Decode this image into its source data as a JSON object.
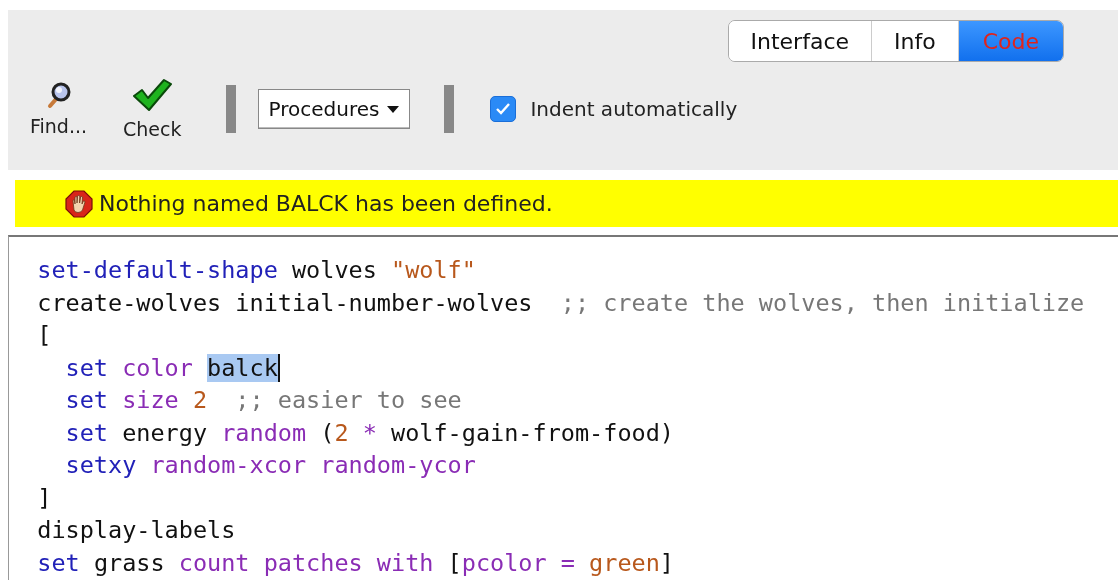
{
  "tabs": [
    {
      "label": "Interface",
      "selected": false
    },
    {
      "label": "Info",
      "selected": false
    },
    {
      "label": "Code",
      "selected": true
    }
  ],
  "toolbar": {
    "find": {
      "label": "Find..."
    },
    "check": {
      "label": "Check"
    },
    "procedures_menu": {
      "label": "Procedures"
    },
    "indent_checkbox": {
      "label": "Indent automatically",
      "checked": true
    }
  },
  "error_message": {
    "text": "Nothing named BALCK has been defined."
  },
  "code_lines": [
    {
      "tokens": [
        {
          "kind": "keyword",
          "text": "set-default-shape"
        },
        {
          "kind": "plain",
          "text": " wolves"
        },
        {
          "kind": "string",
          "text": " \"wolf\""
        }
      ]
    },
    {
      "tokens": [
        {
          "kind": "plain",
          "text": "create-wolves"
        },
        {
          "kind": "plain",
          "text": " initial-number-wolves"
        },
        {
          "kind": "comment",
          "text": "  ;; create the wolves, then initialize"
        }
      ]
    },
    {
      "tokens": [
        {
          "kind": "plain",
          "text": "["
        }
      ],
      "children": [
        {
          "tokens": [
            {
              "kind": "keyword",
              "text": "set"
            },
            {
              "kind": "primitive",
              "text": " color "
            },
            {
              "kind": "selection",
              "text": "balck"
            }
          ]
        },
        {
          "tokens": [
            {
              "kind": "keyword",
              "text": "set"
            },
            {
              "kind": "primitive",
              "text": " size"
            },
            {
              "kind": "number",
              "text": " 2"
            },
            {
              "kind": "comment",
              "text": "  ;; easier to see"
            }
          ]
        },
        {
          "tokens": [
            {
              "kind": "keyword",
              "text": "set"
            },
            {
              "kind": "plain",
              "text": " energy"
            },
            {
              "kind": "primitive",
              "text": " random"
            },
            {
              "kind": "plain",
              "text": " ("
            },
            {
              "kind": "number",
              "text": "2"
            },
            {
              "kind": "primitive",
              "text": " *"
            },
            {
              "kind": "plain",
              "text": " wolf-gain-from-food)"
            }
          ]
        },
        {
          "tokens": [
            {
              "kind": "keyword",
              "text": "setxy"
            },
            {
              "kind": "primitive",
              "text": " random-xcor"
            },
            {
              "kind": "primitive",
              "text": " random-ycor"
            }
          ]
        }
      ]
    },
    {
      "tokens": [
        {
          "kind": "plain",
          "text": "]"
        }
      ]
    },
    {
      "tokens": [
        {
          "kind": "plain",
          "text": "display-labels"
        }
      ]
    },
    {
      "tokens": [
        {
          "kind": "keyword",
          "text": "set"
        },
        {
          "kind": "plain",
          "text": " grass"
        },
        {
          "kind": "primitive",
          "text": " count"
        },
        {
          "kind": "primitive",
          "text": " patches"
        },
        {
          "kind": "primitive",
          "text": " with"
        },
        {
          "kind": "plain",
          "text": " ["
        },
        {
          "kind": "primitive",
          "text": "pcolor"
        },
        {
          "kind": "primitive",
          "text": " ="
        },
        {
          "kind": "number",
          "text": " green"
        },
        {
          "kind": "plain",
          "text": "]"
        }
      ]
    }
  ]
}
